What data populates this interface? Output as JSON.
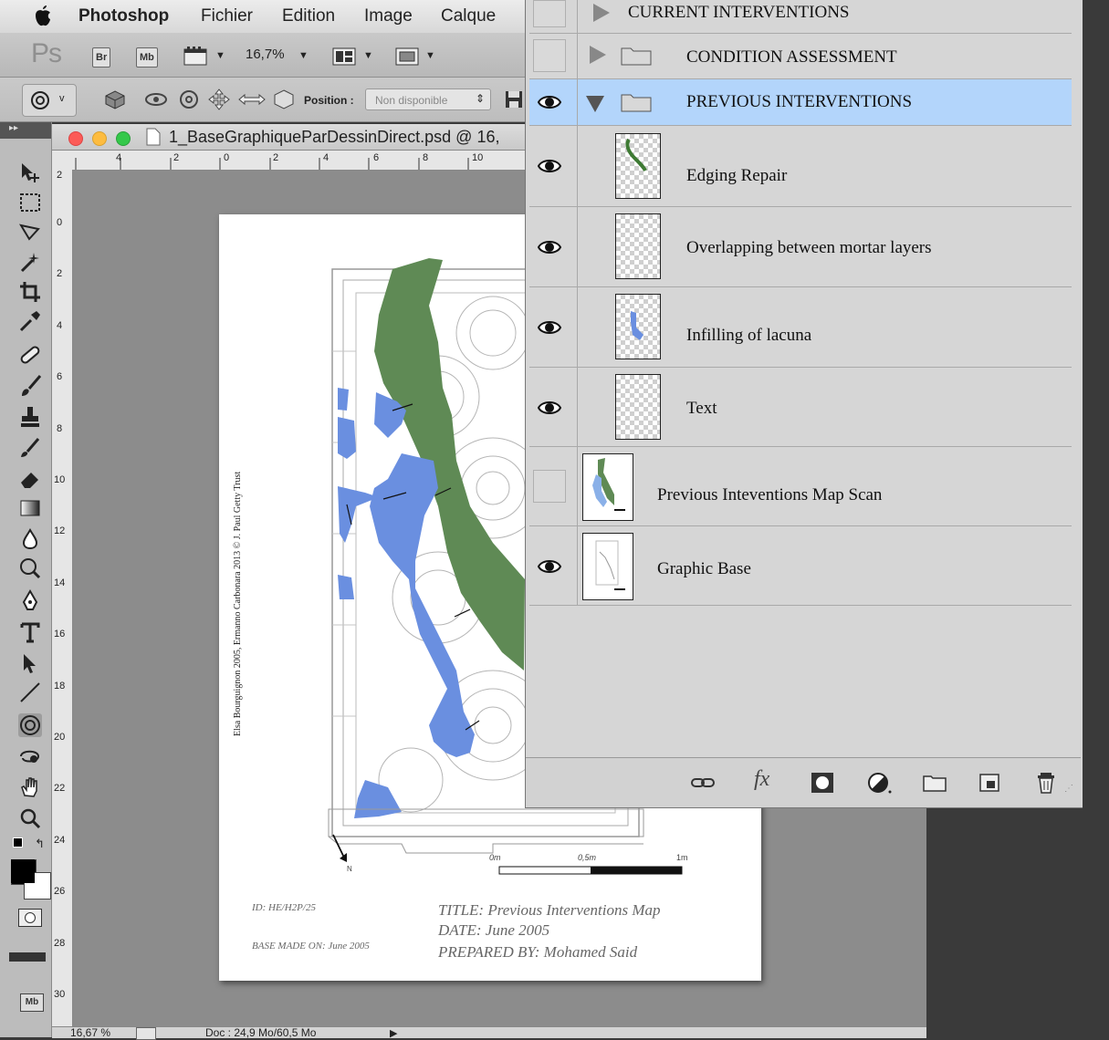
{
  "menubar": {
    "items": [
      "Photoshop",
      "Fichier",
      "Edition",
      "Image",
      "Calque"
    ]
  },
  "appbar": {
    "logo": "Ps",
    "bridge_badge": "Br",
    "minibridge_badge": "Mb",
    "zoom_value": "16,7%"
  },
  "options": {
    "position_label": "Position :",
    "position_value": "Non disponible"
  },
  "document": {
    "tab_title": "1_BaseGraphiqueParDessinDirect.psd @ 16,",
    "ruler_top": [
      "4",
      "2",
      "0",
      "2",
      "4",
      "6",
      "8",
      "10"
    ],
    "ruler_left": [
      "2",
      "0",
      "2",
      "4",
      "6",
      "8",
      "10",
      "12",
      "14",
      "16",
      "18",
      "20",
      "22",
      "24",
      "26",
      "28",
      "30"
    ]
  },
  "page": {
    "credit": "Elsa Bourguignon 2005, Ermanno Carbonara 2013 © J. Paul Getty Trust",
    "north": "N",
    "scale_labels": [
      "0m",
      "0,5m",
      "1m"
    ],
    "id": "ID: HE/H2P/25",
    "base_made": "BASE MADE ON: June 2005",
    "title": "TITLE: Previous Interventions Map",
    "date": "DATE: June 2005",
    "prepared": "PREPARED BY: Mohamed Said"
  },
  "status": {
    "zoom": "16,67 %",
    "doc": "Doc : 24,9 Mo/60,5 Mo"
  },
  "layers": {
    "rows": [
      {
        "name": "CURRENT INTERVENTIONS",
        "type": "group",
        "visible": false
      },
      {
        "name": "CONDITION ASSESSMENT",
        "type": "group",
        "visible": false
      },
      {
        "name": "PREVIOUS INTERVENTIONS",
        "type": "group",
        "visible": true,
        "expanded": true,
        "selected": true
      },
      {
        "name": "Edging Repair",
        "type": "layer",
        "visible": true
      },
      {
        "name": "Overlapping between mortar layers",
        "type": "layer",
        "visible": true
      },
      {
        "name": "Infilling of lacuna",
        "type": "layer",
        "visible": true
      },
      {
        "name": "Text",
        "type": "layer",
        "visible": true
      },
      {
        "name": "Previous Inteventions Map Scan",
        "type": "layer",
        "visible": false
      },
      {
        "name": "Graphic Base",
        "type": "layer",
        "visible": true
      }
    ],
    "selected_color": "#b3d5fb"
  },
  "colors": {
    "green_area": "#5f8a55",
    "blue_area": "#6a8fe0"
  }
}
